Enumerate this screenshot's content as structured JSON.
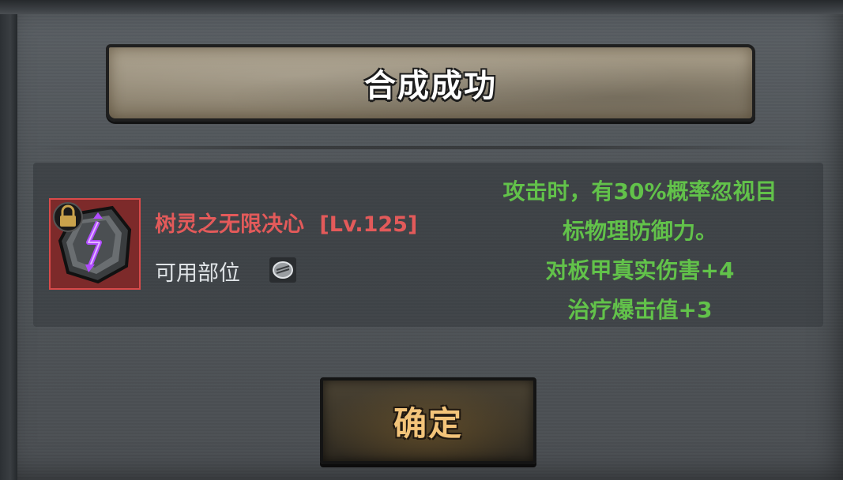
{
  "dialog": {
    "title": "合成成功"
  },
  "item": {
    "name": "树灵之无限决心",
    "level_tag": "[Lv.125]",
    "icon": "rune-stone-icon",
    "locked_icon": "lock-icon",
    "slot_label": "可用部位",
    "slot_icon": "ring-slot-icon",
    "name_color": "#e35a5a"
  },
  "effects": {
    "lines": [
      "攻击时，有30%概率忽视目",
      "标物理防御力。",
      "对板甲真实伤害+4",
      "治疗爆击值+3"
    ],
    "color": "#62c24a"
  },
  "confirm": {
    "label": "确定"
  }
}
